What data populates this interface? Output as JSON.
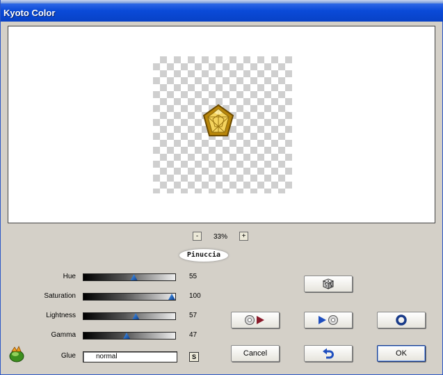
{
  "window": {
    "title": "Kyoto Color"
  },
  "zoom": {
    "minus_label": "-",
    "plus_label": "+",
    "level": "33%"
  },
  "brand": {
    "logo_text": "Pinuccia"
  },
  "sliders": [
    {
      "label": "Hue",
      "value": "55",
      "fraction": 0.55
    },
    {
      "label": "Saturation",
      "value": "100",
      "fraction": 1.0
    },
    {
      "label": "Lightness",
      "value": "57",
      "fraction": 0.57
    },
    {
      "label": "Gamma",
      "value": "47",
      "fraction": 0.47
    }
  ],
  "glue": {
    "label": "Glue",
    "value": "normal",
    "s_label": "S"
  },
  "buttons": {
    "cancel": "Cancel",
    "ok": "OK",
    "random_icon": "dice-icon",
    "load_icon": "disc-arrow-left-icon",
    "save_icon": "arrow-disc-right-icon",
    "reset_icon": "ring-icon",
    "undo_icon": "undo-arrow-icon"
  },
  "colors": {
    "title_bar": "#0842c6",
    "accent_blue": "#1f4fbf"
  }
}
